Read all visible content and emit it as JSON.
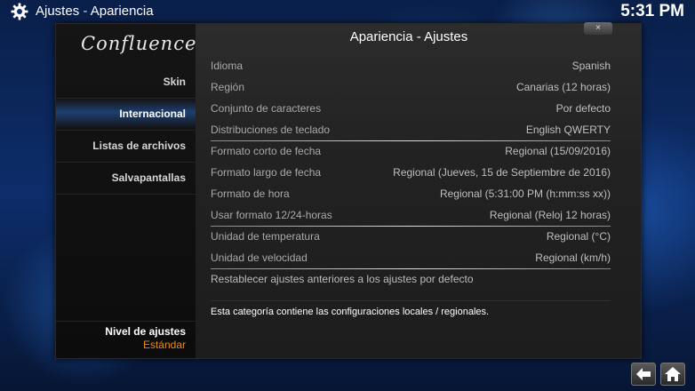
{
  "header": {
    "section": "Ajustes",
    "separator": "-",
    "page": "Apariencia",
    "clock": "5:31 PM"
  },
  "dialog": {
    "title": "Apariencia - Ajustes",
    "close_glyph": "×",
    "logo": "Confluence",
    "menu": [
      {
        "label": "Skin",
        "selected": false
      },
      {
        "label": "Internacional",
        "selected": true
      },
      {
        "label": "Listas de archivos",
        "selected": false
      },
      {
        "label": "Salvapantallas",
        "selected": false
      }
    ],
    "level": {
      "label": "Nivel de ajustes",
      "value": "Estándar"
    },
    "settings": [
      {
        "label": "Idioma",
        "value": "Spanish"
      },
      {
        "label": "Región",
        "value": "Canarias (12 horas)"
      },
      {
        "label": "Conjunto de caracteres",
        "value": "Por defecto"
      },
      {
        "label": "Distribuciones de teclado",
        "value": "English QWERTY"
      },
      {
        "label": "Formato corto de fecha",
        "value": "Regional (15/09/2016)"
      },
      {
        "label": "Formato largo de fecha",
        "value": "Regional (Jueves, 15 de Septiembre de 2016)"
      },
      {
        "label": "Formato de hora",
        "value": "Regional (5:31:00 PM (h:mm:ss xx))"
      },
      {
        "label": "Usar formato 12/24-horas",
        "value": "Regional (Reloj 12 horas)"
      },
      {
        "label": "Unidad de temperatura",
        "value": "Regional (°C)"
      },
      {
        "label": "Unidad de velocidad",
        "value": "Regional (km/h)"
      }
    ],
    "reset_label": "Restablecer ajustes anteriores a los ajustes por defecto",
    "description": "Esta categoría contiene las configuraciones locales / regionales."
  },
  "icons": {
    "app": "gear-icon",
    "back": "back-arrow-icon",
    "home": "home-icon"
  },
  "colors": {
    "accent": "#e88a1a",
    "selection": "#2864be"
  }
}
